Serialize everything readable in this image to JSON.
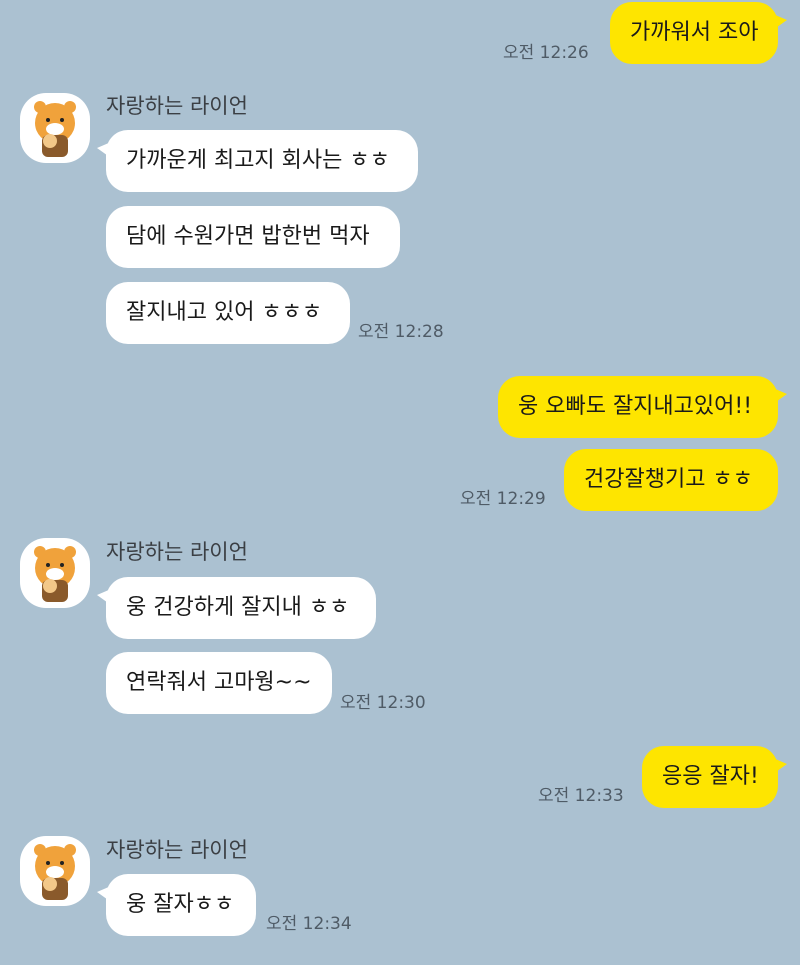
{
  "messages": {
    "m1": {
      "text": "가까워서 조아",
      "time": "오전 12:26"
    },
    "g1": {
      "sender": "자랑하는 라이언",
      "b1": "가까운게 최고지 회사는 ㅎㅎ",
      "b2": "담에 수원가면 밥한번 먹자",
      "b3": "잘지내고 있어 ㅎㅎㅎ",
      "time": "오전 12:28"
    },
    "m2": {
      "b1": "웅 오빠도 잘지내고있어!!",
      "b2": "건강잘챙기고 ㅎㅎ",
      "time": "오전 12:29"
    },
    "g2": {
      "sender": "자랑하는 라이언",
      "b1": "웅 건강하게 잘지내 ㅎㅎ",
      "b2": "연락줘서 고마웡~~",
      "time": "오전 12:30"
    },
    "m3": {
      "text": "응응 잘자!",
      "time": "오전 12:33"
    },
    "g3": {
      "sender": "자랑하는 라이언",
      "b1": "웅 잘자ㅎㅎ",
      "time": "오전 12:34"
    }
  },
  "colors": {
    "background": "#abc1d1",
    "my_bubble": "#fee500",
    "their_bubble": "#ffffff"
  },
  "icons": {
    "avatar": "ryan-character-avatar-icon"
  }
}
